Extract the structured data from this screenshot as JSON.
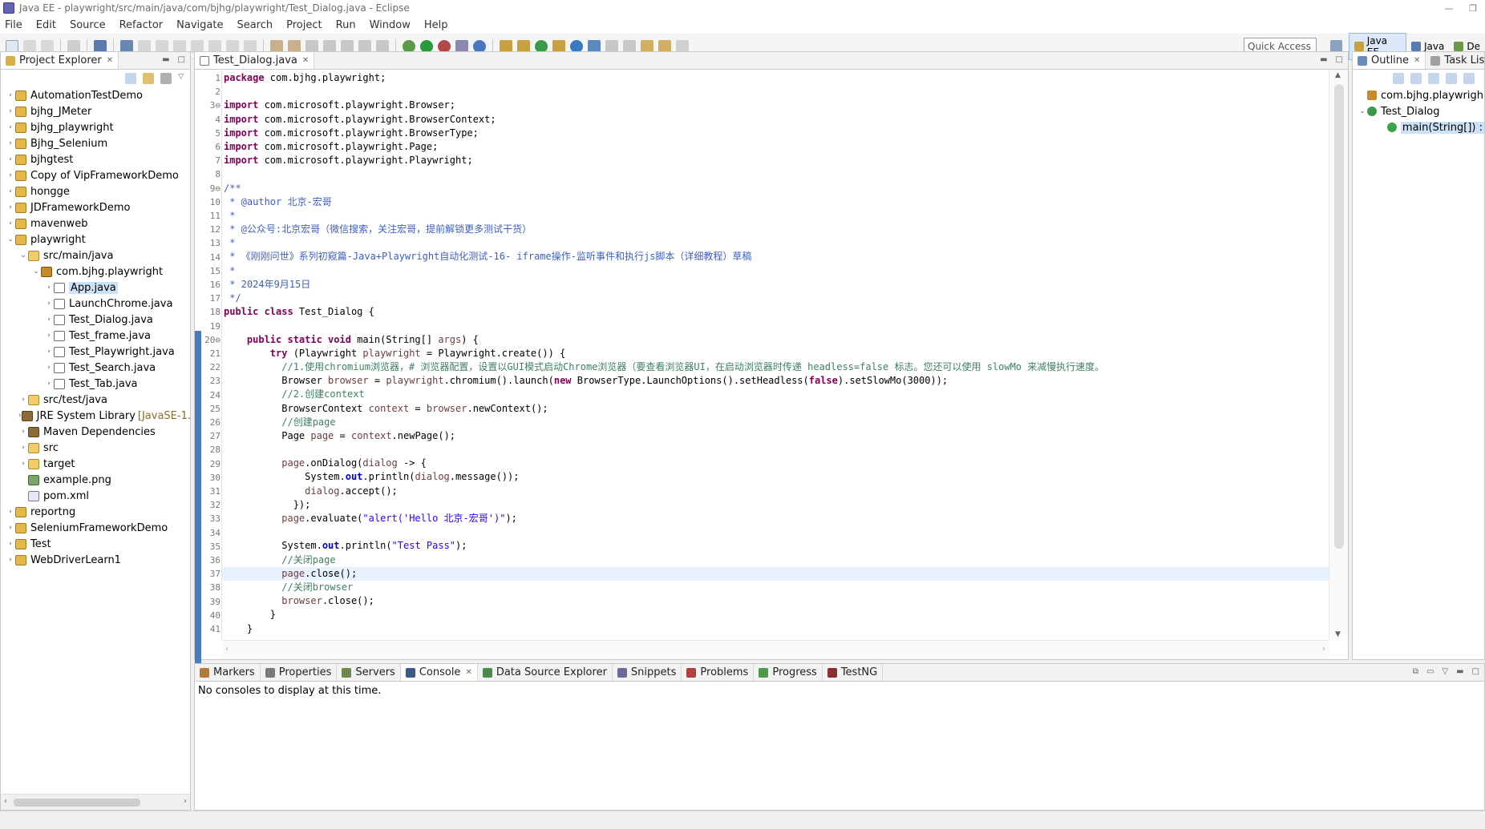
{
  "window": {
    "title": "Java EE - playwright/src/main/java/com/bjhg/playwright/Test_Dialog.java - Eclipse"
  },
  "menu": [
    "File",
    "Edit",
    "Source",
    "Refactor",
    "Navigate",
    "Search",
    "Project",
    "Run",
    "Window",
    "Help"
  ],
  "toolbar": {
    "quick_access": "Quick Access"
  },
  "perspectives": [
    {
      "label": "Java EE",
      "active": true
    },
    {
      "label": "Java",
      "active": false
    },
    {
      "label": "De",
      "active": false
    }
  ],
  "project_explorer": {
    "tab": "Project Explorer",
    "items": [
      {
        "label": "AutomationTestDemo",
        "depth": 0,
        "arrow": "›",
        "icon": "project"
      },
      {
        "label": "bjhg_JMeter",
        "depth": 0,
        "arrow": "›",
        "icon": "project"
      },
      {
        "label": "bjhg_playwright",
        "depth": 0,
        "arrow": "›",
        "icon": "project"
      },
      {
        "label": "Bjhg_Selenium",
        "depth": 0,
        "arrow": "›",
        "icon": "project"
      },
      {
        "label": "bjhgtest",
        "depth": 0,
        "arrow": "›",
        "icon": "project"
      },
      {
        "label": "Copy of VipFrameworkDemo",
        "depth": 0,
        "arrow": "›",
        "icon": "project"
      },
      {
        "label": "hongge",
        "depth": 0,
        "arrow": "›",
        "icon": "project"
      },
      {
        "label": "JDFrameworkDemo",
        "depth": 0,
        "arrow": "›",
        "icon": "project"
      },
      {
        "label": "mavenweb",
        "depth": 0,
        "arrow": "›",
        "icon": "project"
      },
      {
        "label": "playwright",
        "depth": 0,
        "arrow": "⌄",
        "icon": "project"
      },
      {
        "label": "src/main/java",
        "depth": 1,
        "arrow": "⌄",
        "icon": "folder"
      },
      {
        "label": "com.bjhg.playwright",
        "depth": 2,
        "arrow": "⌄",
        "icon": "package"
      },
      {
        "label": "App.java",
        "depth": 3,
        "arrow": "›",
        "icon": "java",
        "selected": true
      },
      {
        "label": "LaunchChrome.java",
        "depth": 3,
        "arrow": "›",
        "icon": "java"
      },
      {
        "label": "Test_Dialog.java",
        "depth": 3,
        "arrow": "›",
        "icon": "java"
      },
      {
        "label": "Test_frame.java",
        "depth": 3,
        "arrow": "›",
        "icon": "java"
      },
      {
        "label": "Test_Playwright.java",
        "depth": 3,
        "arrow": "›",
        "icon": "java"
      },
      {
        "label": "Test_Search.java",
        "depth": 3,
        "arrow": "›",
        "icon": "java"
      },
      {
        "label": "Test_Tab.java",
        "depth": 3,
        "arrow": "›",
        "icon": "java"
      },
      {
        "label": "src/test/java",
        "depth": 1,
        "arrow": "›",
        "icon": "folder"
      },
      {
        "label": "JRE System Library",
        "suffix": "[JavaSE-1.",
        "depth": 1,
        "arrow": "›",
        "icon": "lib"
      },
      {
        "label": "Maven Dependencies",
        "depth": 1,
        "arrow": "›",
        "icon": "lib"
      },
      {
        "label": "src",
        "depth": 1,
        "arrow": "›",
        "icon": "folder"
      },
      {
        "label": "target",
        "depth": 1,
        "arrow": "›",
        "icon": "folder"
      },
      {
        "label": "example.png",
        "depth": 1,
        "arrow": "",
        "icon": "png"
      },
      {
        "label": "pom.xml",
        "depth": 1,
        "arrow": "",
        "icon": "xml"
      },
      {
        "label": "reportng",
        "depth": 0,
        "arrow": "›",
        "icon": "project"
      },
      {
        "label": "SeleniumFrameworkDemo",
        "depth": 0,
        "arrow": "›",
        "icon": "project"
      },
      {
        "label": "Test",
        "depth": 0,
        "arrow": "›",
        "icon": "project"
      },
      {
        "label": "WebDriverLearn1",
        "depth": 0,
        "arrow": "›",
        "icon": "project"
      }
    ]
  },
  "editor": {
    "tab": "Test_Dialog.java",
    "current_line": 37,
    "lines": [
      {
        "n": "1",
        "html": "<span class='kw'>package</span> com.bjhg.playwright;"
      },
      {
        "n": "2",
        "html": ""
      },
      {
        "n": "3⊖",
        "html": "<span class='kw'>import</span> com.microsoft.playwright.Browser;"
      },
      {
        "n": "4",
        "html": "<span class='kw'>import</span> com.microsoft.playwright.BrowserContext;"
      },
      {
        "n": "5",
        "html": "<span class='kw'>import</span> com.microsoft.playwright.BrowserType;"
      },
      {
        "n": "6",
        "html": "<span class='kw'>import</span> com.microsoft.playwright.Page;"
      },
      {
        "n": "7",
        "html": "<span class='kw'>import</span> com.microsoft.playwright.Playwright;"
      },
      {
        "n": "8",
        "html": ""
      },
      {
        "n": "9⊖",
        "html": "<span class='jd'>/**</span>"
      },
      {
        "n": "10",
        "html": "<span class='jd'> * @author 北京-宏哥</span>"
      },
      {
        "n": "11",
        "html": "<span class='jd'> *</span>"
      },
      {
        "n": "12",
        "html": "<span class='jd'> * @公众号:北京宏哥（微信搜索，关注宏哥，提前解锁更多测试干货）</span>"
      },
      {
        "n": "13",
        "html": "<span class='jd'> *</span>"
      },
      {
        "n": "14",
        "html": "<span class='jd'> * 《刚刚问世》系列初窥篇-Java+Playwright自动化测试-16- iframe操作-监听事件和执行js脚本（详细教程）草稿</span>"
      },
      {
        "n": "15",
        "html": "<span class='jd'> *</span>"
      },
      {
        "n": "16",
        "html": "<span class='jd'> * 2024年9月15日</span>"
      },
      {
        "n": "17",
        "html": "<span class='jd'> */</span>"
      },
      {
        "n": "18",
        "html": "<span class='kw'>public class</span> Test_Dialog {"
      },
      {
        "n": "19",
        "html": ""
      },
      {
        "n": "20⊖",
        "html": "    <span class='kw'>public static void</span> main(String[] <span class='var'>args</span>) {"
      },
      {
        "n": "21",
        "html": "        <span class='kw'>try</span> (Playwright <span class='var'>playwright</span> = Playwright.create()) {"
      },
      {
        "n": "22",
        "html": "          <span class='cmt'>//1.使用chromium浏览器，# 浏览器配置，设置以GUI模式启动Chrome浏览器（要查看浏览器UI，在启动浏览器时传递 headless=false 标志。您还可以使用 slowMo 来减慢执行速度。</span>"
      },
      {
        "n": "23",
        "html": "          Browser <span class='var'>browser</span> = <span class='var'>playwright</span>.chromium().launch(<span class='kw'>new</span> BrowserType.LaunchOptions().setHeadless(<span class='kw'>false</span>).setSlowMo(3000));"
      },
      {
        "n": "24",
        "html": "          <span class='cmt'>//2.创建context</span>"
      },
      {
        "n": "25",
        "html": "          BrowserContext <span class='var'>context</span> = <span class='var'>browser</span>.newContext();"
      },
      {
        "n": "26",
        "html": "          <span class='cmt'>//创建page</span>"
      },
      {
        "n": "27",
        "html": "          Page <span class='var'>page</span> = <span class='var'>context</span>.newPage();"
      },
      {
        "n": "28",
        "html": ""
      },
      {
        "n": "29",
        "html": "          <span class='var'>page</span>.onDialog(<span class='var'>dialog</span> -> {"
      },
      {
        "n": "30",
        "html": "              System.<span class='fld'>out</span>.println(<span class='var'>dialog</span>.message());"
      },
      {
        "n": "31",
        "html": "              <span class='var'>dialog</span>.accept();"
      },
      {
        "n": "32",
        "html": "            });"
      },
      {
        "n": "33",
        "html": "          <span class='var'>page</span>.evaluate(<span class='str'>\"alert('Hello 北京-宏哥')\"</span>);"
      },
      {
        "n": "34",
        "html": ""
      },
      {
        "n": "35",
        "html": "          System.<span class='fld'>out</span>.println(<span class='str'>\"Test Pass\"</span>);"
      },
      {
        "n": "36",
        "html": "          <span class='cmt'>//关闭page</span>"
      },
      {
        "n": "37",
        "html": "          <span class='var'>page</span>.close();"
      },
      {
        "n": "38",
        "html": "          <span class='cmt'>//关闭browser</span>"
      },
      {
        "n": "39",
        "html": "          <span class='var'>browser</span>.close();"
      },
      {
        "n": "40",
        "html": "        }"
      },
      {
        "n": "41",
        "html": "    }"
      }
    ]
  },
  "outline": {
    "tab": "Outline",
    "tab2": "Task List",
    "items": [
      {
        "label": "com.bjhg.playwrigh",
        "depth": 0,
        "arrow": ""
      },
      {
        "label": "Test_Dialog",
        "depth": 0,
        "arrow": "⌄"
      },
      {
        "label": "main(String[]) :",
        "depth": 1,
        "arrow": "",
        "selected": true
      }
    ]
  },
  "bottom_panel": {
    "tabs": [
      {
        "label": "Markers",
        "active": false,
        "color": "#b07a3a"
      },
      {
        "label": "Properties",
        "active": false,
        "color": "#7a7a7a"
      },
      {
        "label": "Servers",
        "active": false,
        "color": "#6a8a4a"
      },
      {
        "label": "Console",
        "active": true,
        "color": "#3a5a8a"
      },
      {
        "label": "Data Source Explorer",
        "active": false,
        "color": "#4a8a4a"
      },
      {
        "label": "Snippets",
        "active": false,
        "color": "#6a6a9a"
      },
      {
        "label": "Problems",
        "active": false,
        "color": "#b04040"
      },
      {
        "label": "Progress",
        "active": false,
        "color": "#4a9a4a"
      },
      {
        "label": "TestNG",
        "active": false,
        "color": "#8a3030"
      }
    ],
    "message": "No consoles to display at this time."
  }
}
